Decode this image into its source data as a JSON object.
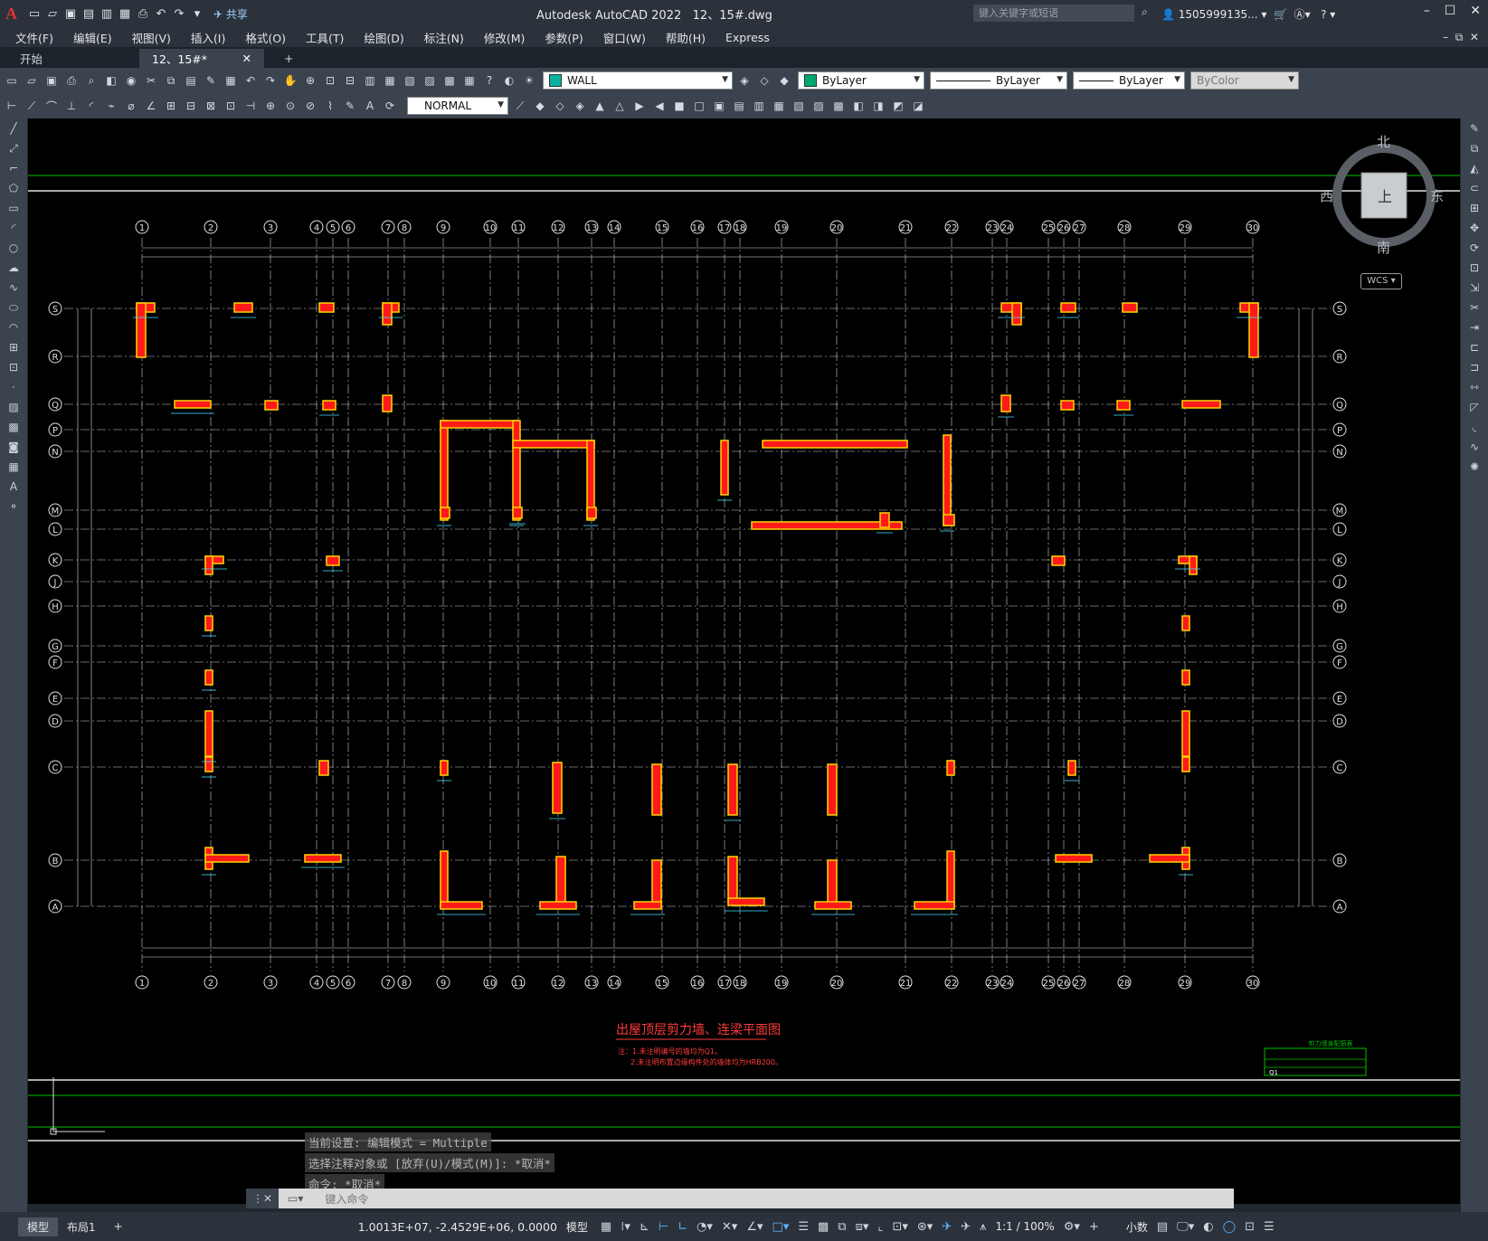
{
  "app": {
    "title": "Autodesk AutoCAD 2022",
    "file": "12、15#.dwg",
    "share_label": "共享",
    "search_placeholder": "键入关键字或短语",
    "user": "1505999135...",
    "brand_color": "#e0332f"
  },
  "menu": [
    "文件(F)",
    "编辑(E)",
    "视图(V)",
    "插入(I)",
    "格式(O)",
    "工具(T)",
    "绘图(D)",
    "标注(N)",
    "修改(M)",
    "参数(P)",
    "窗口(W)",
    "帮助(H)",
    "Express"
  ],
  "tabs": {
    "start": "开始",
    "doc": "12、15#*",
    "add": "+"
  },
  "toolbar": {
    "layer": "WALL",
    "color": "ByLayer",
    "linetype": "ByLayer",
    "lineweight": "ByLayer",
    "plotstyle": "ByColor",
    "dimstyle": "NORMAL"
  },
  "viewcube": {
    "north": "北",
    "south": "南",
    "east": "东",
    "west": "西",
    "top": "上",
    "wcs": "WCS"
  },
  "drawing": {
    "title": "出屋顶层剪力墙、连梁平面图",
    "note1": "注：1.未注明编号的墙均为Q1。",
    "note2": "2.未注明布置边缘构件处的墙体均为HRB200。",
    "grid_cols": [
      "1",
      "2",
      "3",
      "4",
      "5",
      "6",
      "7",
      "8",
      "9",
      "10",
      "11",
      "12",
      "13",
      "14",
      "15",
      "16",
      "17",
      "18",
      "19",
      "20",
      "21",
      "22",
      "23",
      "24",
      "25",
      "26",
      "27",
      "28",
      "29",
      "30"
    ],
    "grid_rows": [
      "S",
      "R",
      "Q",
      "P",
      "N",
      "M",
      "L",
      "K",
      "J",
      "H",
      "G",
      "F",
      "E",
      "D",
      "C",
      "B",
      "A"
    ],
    "legend_title": "剪力墙身配筋表",
    "legend_row": "Q1"
  },
  "command": {
    "line1": "当前设置: 编辑模式 = Multiple",
    "line2": "选择注释对象或 [放弃(U)/模式(M)]: *取消*",
    "line3": "命令: *取消*",
    "placeholder": "键入命令"
  },
  "status": {
    "model_tab": "模型",
    "layout_tab": "布局1",
    "add": "+",
    "coords": "1.0013E+07, -2.4529E+06, 0.0000",
    "mode": "模型",
    "scale": "1:1 / 100%",
    "units": "小数"
  },
  "colors": {
    "canvas": "#000000",
    "grid_line": "#ffffff",
    "wall_fill": "#ff1a1a",
    "wall_edge": "#ffd400",
    "dim": "#40e0ff",
    "green_line": "#00c000",
    "title_red": "#ff3b3b"
  }
}
